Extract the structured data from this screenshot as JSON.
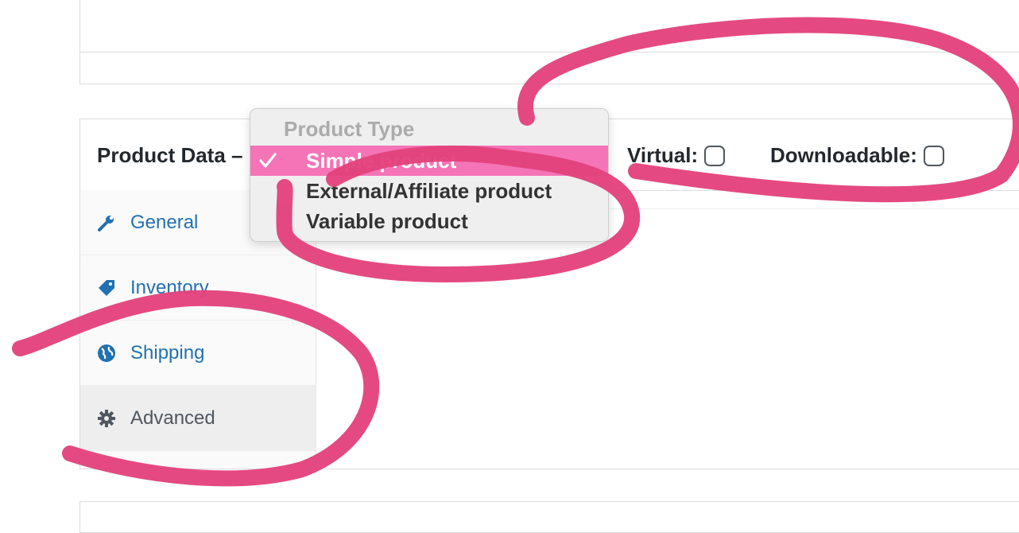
{
  "header": {
    "title": "Product Data –",
    "virtual_label": "Virtual:",
    "downloadable_label": "Downloadable:"
  },
  "product_type_dropdown": {
    "group_label": "Product Type",
    "options": [
      {
        "label": "Simple product",
        "selected": true
      },
      {
        "label": "External/Affiliate product",
        "selected": false
      },
      {
        "label": "Variable product",
        "selected": false
      }
    ]
  },
  "tabs": [
    {
      "label": "General",
      "icon": "wrench-icon",
      "active": false
    },
    {
      "label": "Inventory",
      "icon": "tag-icon",
      "active": false
    },
    {
      "label": "Shipping",
      "icon": "globe-icon",
      "active": false
    },
    {
      "label": "Advanced",
      "icon": "gear-icon",
      "active": true
    }
  ],
  "colors": {
    "link": "#2271b1",
    "highlight": "#f474b7",
    "annotation": "#e3437c"
  }
}
